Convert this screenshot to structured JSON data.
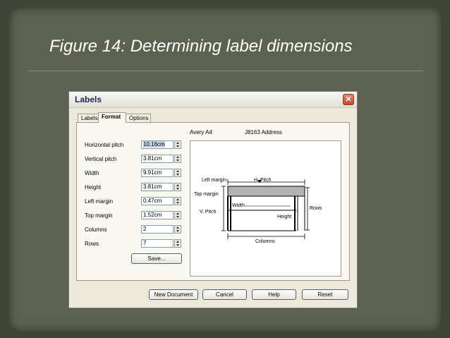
{
  "slide": {
    "title": "Figure 14: Determining label dimensions"
  },
  "dialog": {
    "title": "Labels",
    "tabs": [
      "Labels",
      "Format",
      "Options"
    ],
    "active_tab": "Format",
    "fields": [
      {
        "label": "Horizontal pitch",
        "value": "10.16cm"
      },
      {
        "label": "Vertical pitch",
        "value": "3.81cm"
      },
      {
        "label": "Width",
        "value": "9.91cm"
      },
      {
        "label": "Height",
        "value": "3.81cm"
      },
      {
        "label": "Left margin",
        "value": "0.47cm"
      },
      {
        "label": "Top margin",
        "value": "1.52cm"
      },
      {
        "label": "Columns",
        "value": "2"
      },
      {
        "label": "Rows",
        "value": "7"
      }
    ],
    "save_label": "Save...",
    "preview": {
      "brand": "Avery A4",
      "product": "J8163 Address",
      "left_margin": "Left margin",
      "h_pitch": "H. Pitch",
      "top_margin": "Top margin",
      "v_pitch": "V. Pitch",
      "width": "Width",
      "height": "Height",
      "rows": "Rows",
      "columns": "Columns"
    },
    "buttons": {
      "new_document": "New Document",
      "cancel": "Cancel",
      "help": "Help",
      "reset": "Reset"
    }
  }
}
